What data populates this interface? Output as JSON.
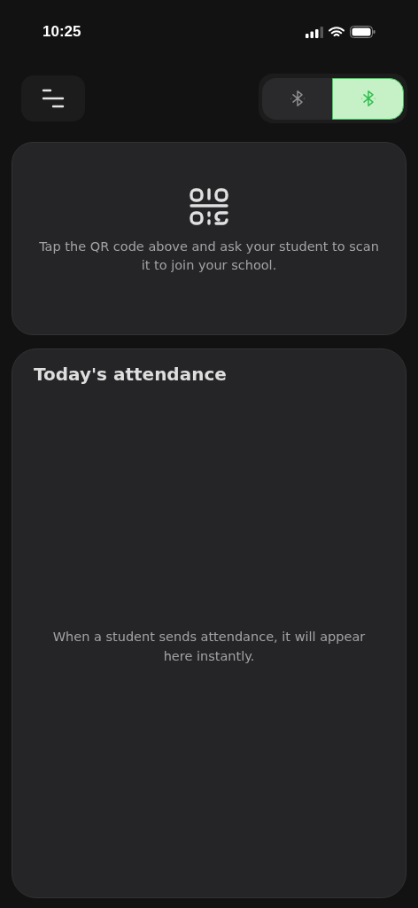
{
  "status_bar": {
    "time": "10:25"
  },
  "mode_toggle": {
    "options": [
      {
        "selected": false
      },
      {
        "selected": true
      }
    ]
  },
  "qr_card": {
    "instruction": "Tap the QR code above and ask your student to scan it to join your school."
  },
  "attendance": {
    "title": "Today's attendance",
    "empty_message": "When a student sends attendance, it will appear here instantly."
  }
}
